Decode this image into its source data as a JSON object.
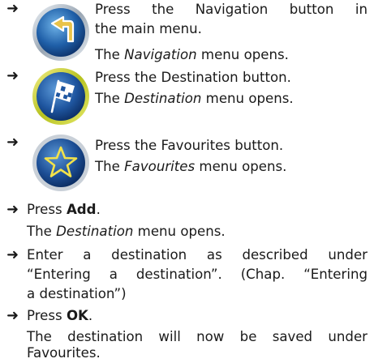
{
  "arrow_glyph": "➜",
  "steps": {
    "navigation": {
      "icon": "navigation-arrow-icon",
      "line1": "Press the Navigation button in",
      "line2": "the main menu.",
      "result_prefix": "The ",
      "result_em": "Navigation",
      "result_suffix": " menu opens."
    },
    "destination": {
      "icon": "destination-flag-icon",
      "line1": "Press the Destination button.",
      "result_prefix": "The ",
      "result_em": "Destination",
      "result_suffix": " menu opens."
    },
    "favourites": {
      "icon": "favourites-star-icon",
      "line1": "Press the Favourites button.",
      "result_prefix": "The ",
      "result_em": "Favourites",
      "result_suffix": " menu opens."
    },
    "add": {
      "prefix": "Press ",
      "bold": "Add",
      "suffix": ".",
      "result_prefix": "The ",
      "result_em": "Destination",
      "result_suffix": " menu opens."
    },
    "enter": {
      "line1": "Enter a destination as described under",
      "line2": "“Entering a destination”. (Chap. “Entering",
      "line3": "a destination”)"
    },
    "ok": {
      "prefix": "Press ",
      "bold": "OK",
      "suffix": ".",
      "result_line1": "The destination will now be saved under",
      "result_line2": "Favourites."
    }
  }
}
